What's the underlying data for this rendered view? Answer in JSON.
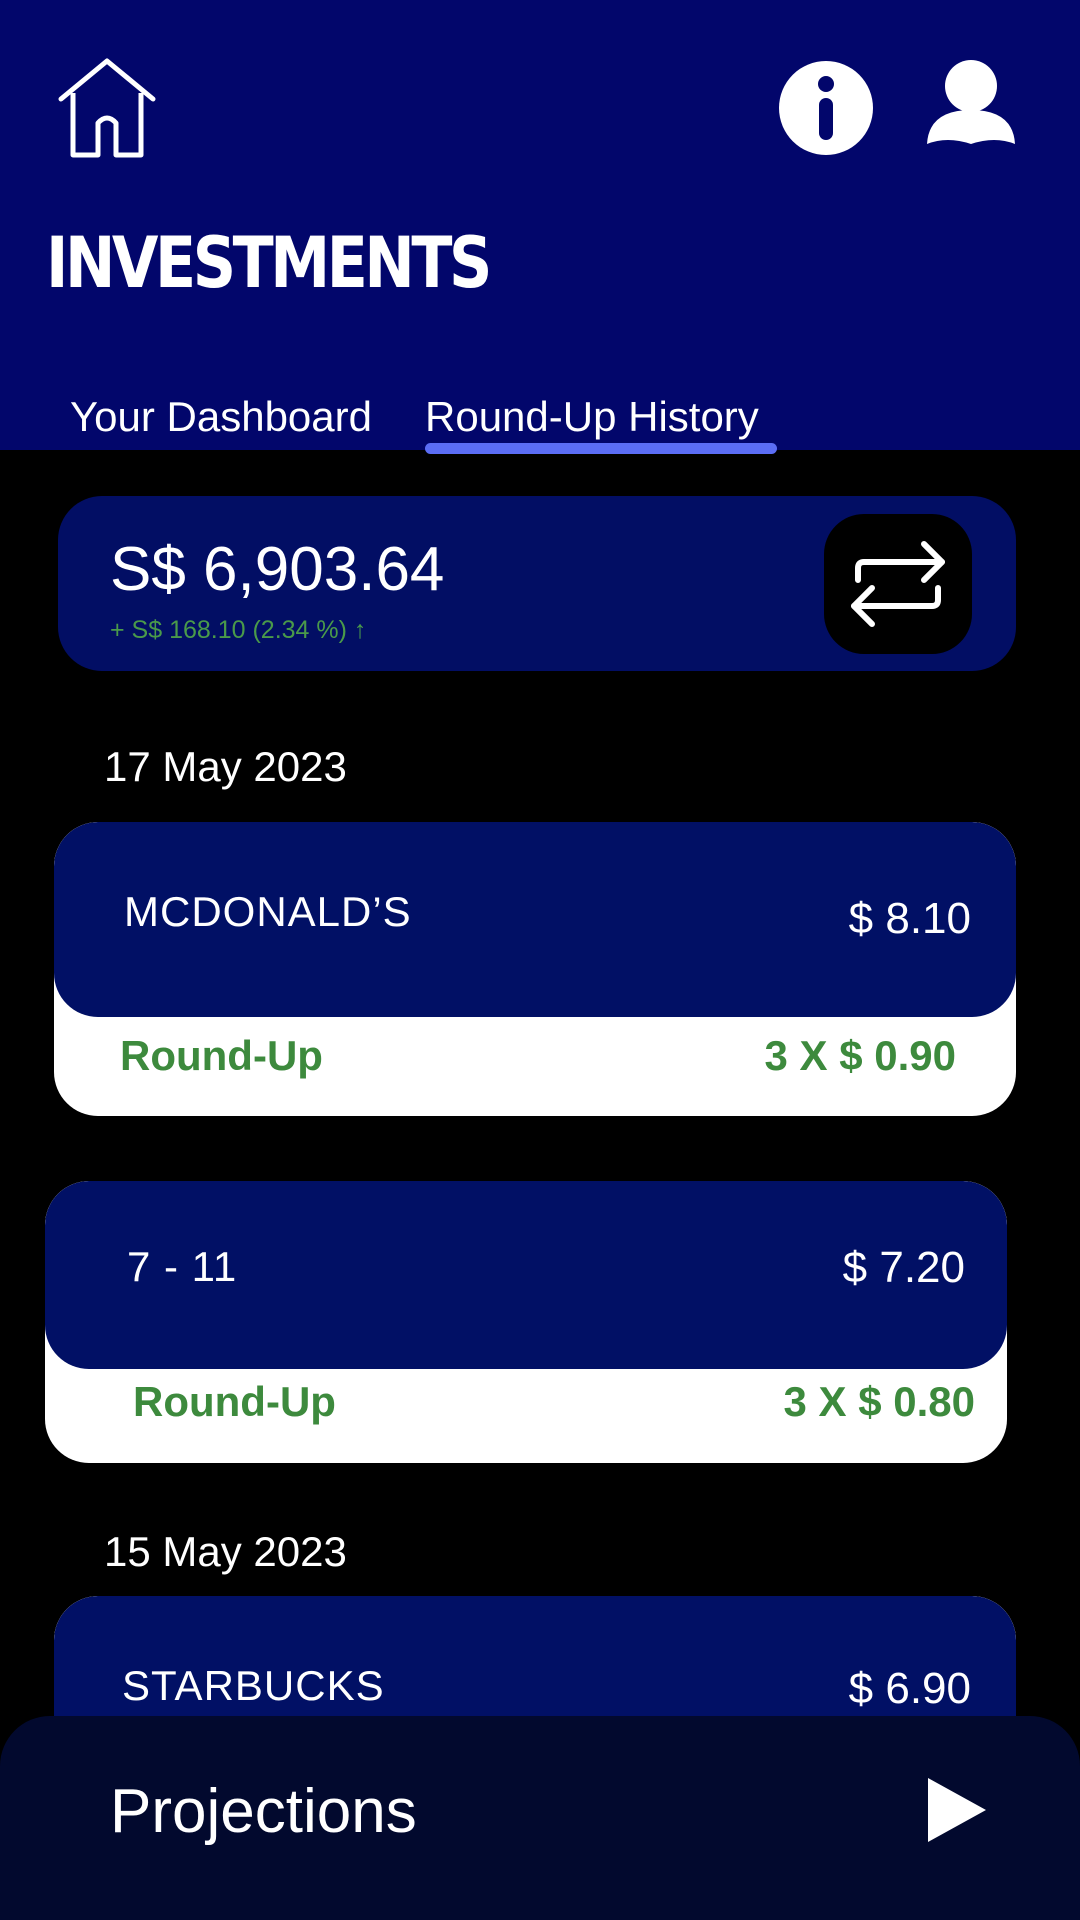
{
  "header": {
    "title": "INVESTMENTS",
    "icons": [
      "home-icon",
      "info-icon",
      "user-icon"
    ],
    "tabs": [
      {
        "label": "Your Dashboard",
        "active": false
      },
      {
        "label": "Round-Up History",
        "active": true
      }
    ]
  },
  "balance": {
    "amount": "S$ 6,903.64",
    "change": "+ S$ 168.10 (2.34 %) ↑",
    "action_icon": "swap-icon"
  },
  "history": {
    "groups": [
      {
        "date": "17 May 2023",
        "transactions": [
          {
            "merchant": "MCDONALD’S",
            "amount": "$ 8.10",
            "roundup_label": "Round-Up",
            "roundup_value": "3 X $ 0.90"
          },
          {
            "merchant": "7 - 11",
            "amount": "$ 7.20",
            "roundup_label": "Round-Up",
            "roundup_value": "3 X $ 0.80"
          }
        ]
      },
      {
        "date": "15 May 2023",
        "transactions": [
          {
            "merchant": "STARBUCKS",
            "amount": "$ 6.90"
          }
        ]
      }
    ]
  },
  "footer": {
    "label": "Projections",
    "icon": "play-icon"
  },
  "colors": {
    "header_bg": "#02066b",
    "card_bg": "#011065",
    "accent_underline": "#5b6df5",
    "positive_green": "#3d8a3d",
    "footer_bg": "#02092e"
  }
}
